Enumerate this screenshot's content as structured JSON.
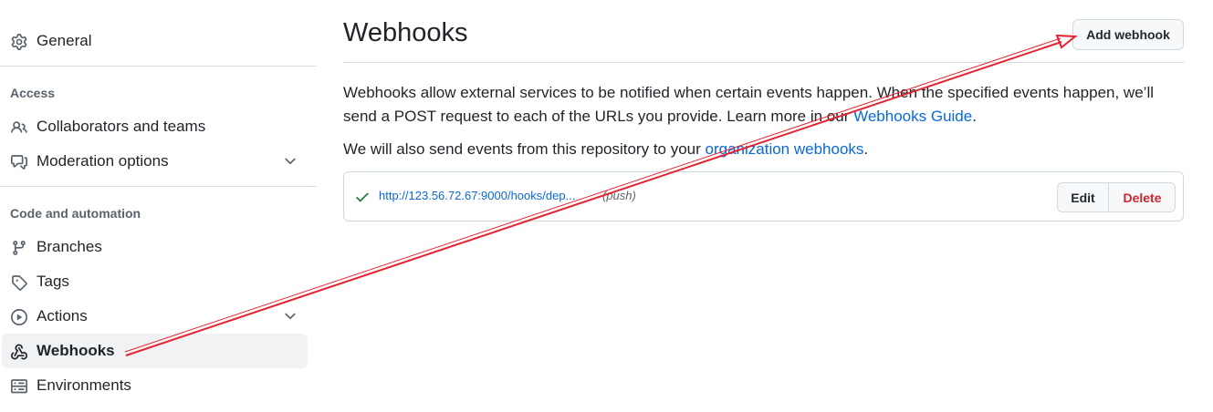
{
  "sidebar": {
    "general": {
      "label": "General",
      "icon": "gear-icon"
    },
    "access_title": "Access",
    "collaborators": {
      "label": "Collaborators and teams",
      "icon": "people-icon"
    },
    "moderation": {
      "label": "Moderation options",
      "icon": "comment-discussion-icon"
    },
    "code_automation_title": "Code and automation",
    "branches": {
      "label": "Branches",
      "icon": "git-branch-icon"
    },
    "tags": {
      "label": "Tags",
      "icon": "tag-icon"
    },
    "actions": {
      "label": "Actions",
      "icon": "play-icon"
    },
    "webhooks": {
      "label": "Webhooks",
      "icon": "webhook-icon",
      "active": true
    },
    "environments": {
      "label": "Environments",
      "icon": "server-icon"
    }
  },
  "main": {
    "title": "Webhooks",
    "add_button": "Add webhook",
    "description": {
      "part1": "Webhooks allow external services to be notified when certain events happen. When the specified events happen, we’ll send a POST request to each of the URLs you provide. Learn more in our ",
      "guide_link": "Webhooks Guide",
      "part2": "."
    },
    "org_note": {
      "part1": "We will also send events from this repository to your ",
      "org_link": "organization webhooks",
      "part2": "."
    },
    "webhook": {
      "status_icon": "check-icon",
      "url": "http://123.56.72.67:9000/hooks/dep...",
      "events": "(push)",
      "edit_label": "Edit",
      "delete_label": "Delete"
    }
  },
  "colors": {
    "link": "#0969da",
    "danger": "#d1242f",
    "success": "#1a7f37",
    "annotation_arrow": "#e5222f"
  }
}
